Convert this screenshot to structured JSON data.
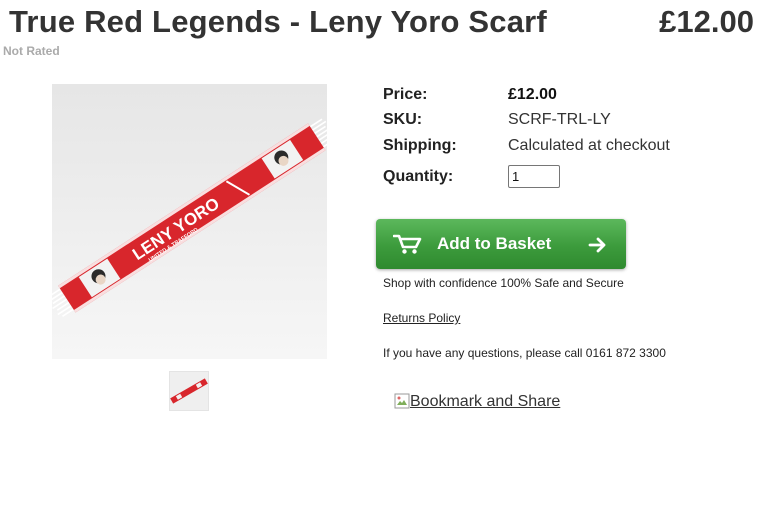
{
  "product": {
    "title": "True Red Legends - Leny Yoro Scarf",
    "header_price": "£12.00",
    "rating_text": "Not Rated"
  },
  "details": {
    "price_label": "Price:",
    "price_value": "£12.00",
    "sku_label": "SKU:",
    "sku_value": "SCRF-TRL-LY",
    "shipping_label": "Shipping:",
    "shipping_value": "Calculated at checkout",
    "quantity_label": "Quantity:",
    "quantity_value": "1"
  },
  "basket_button": {
    "label": "Add to Basket",
    "icons": [
      "cart-icon",
      "arrow-right-icon"
    ],
    "color": "#43a543"
  },
  "info": {
    "confidence": "Shop with confidence 100% Safe and Secure",
    "returns_link": "Returns Policy",
    "questions": "If you have any questions, please call 0161 872 3300"
  },
  "bookmark": {
    "link_text": "Bookmark and Share"
  },
  "scarf_image": {
    "lettering": "LENY YORO",
    "sub_lettering": "UNITED & TRAFFORD",
    "accent": "#d8262c"
  }
}
